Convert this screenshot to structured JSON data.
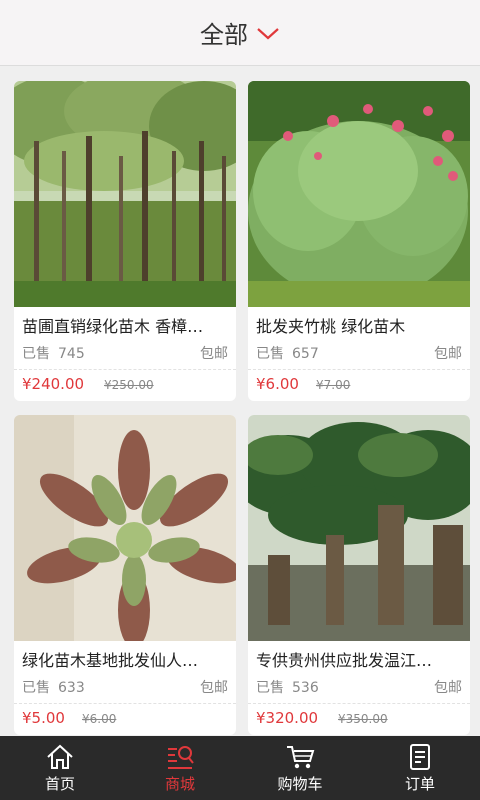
{
  "header": {
    "title": "全部",
    "dropdown_icon": "chevron-down-icon",
    "accent": "#e0383b"
  },
  "products": [
    {
      "name": "苗圃直销绿化苗木 香樟…",
      "sold_label": "已售",
      "sold": "745",
      "shipping": "包邮",
      "price": "¥240.00",
      "original_price": "¥250.00"
    },
    {
      "name": "批发夹竹桃 绿化苗木",
      "sold_label": "已售",
      "sold": "657",
      "shipping": "包邮",
      "price": "¥6.00",
      "original_price": "¥7.00"
    },
    {
      "name": "绿化苗木基地批发仙人…",
      "sold_label": "已售",
      "sold": "633",
      "shipping": "包邮",
      "price": "¥5.00",
      "original_price": "¥6.00"
    },
    {
      "name": "专供贵州供应批发温江…",
      "sold_label": "已售",
      "sold": "536",
      "shipping": "包邮",
      "price": "¥320.00",
      "original_price": "¥350.00"
    }
  ],
  "tabbar": {
    "items": [
      {
        "label": "首页",
        "icon": "home-icon"
      },
      {
        "label": "商城",
        "icon": "store-icon",
        "active": true
      },
      {
        "label": "购物车",
        "icon": "cart-icon"
      },
      {
        "label": "订单",
        "icon": "order-icon"
      }
    ]
  }
}
